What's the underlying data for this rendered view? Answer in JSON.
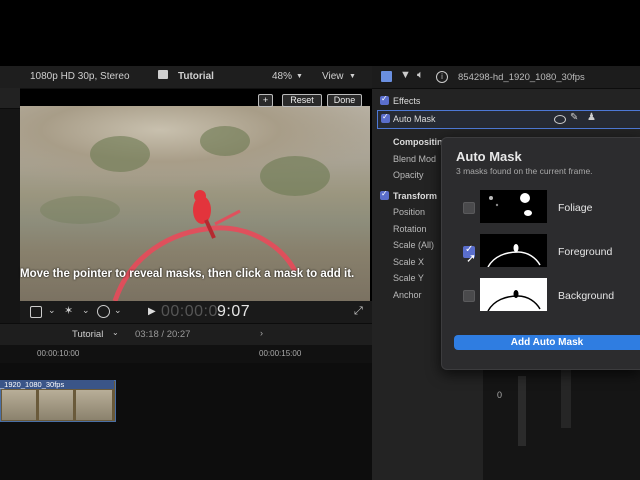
{
  "viewer": {
    "format": "1080p HD 30p, Stereo",
    "project": "Tutorial",
    "zoom": "48%",
    "view_label": "View",
    "add_label": "+",
    "reset_label": "Reset",
    "done_label": "Done",
    "caption": "Move the pointer to reveal masks, then click a mask to add it.",
    "timecode_dim": "00:00:0",
    "timecode_bright": "9:07"
  },
  "timeline": {
    "project": "Tutorial",
    "position": "03:18 / 20:27",
    "ruler_marks": [
      "00:00:10:00",
      "00:00:15:00"
    ],
    "clip_label": "_1920_1080_30fps"
  },
  "inspector": {
    "clip_name": "854298-hd_1920_1080_30fps",
    "effects_label": "Effects",
    "automask_label": "Auto Mask",
    "compositing_label": "Compositin",
    "blend_label": "Blend Mod",
    "opacity_label": "Opacity",
    "transform_label": "Transform",
    "position_label": "Position",
    "rotation_label": "Rotation",
    "scale_all_label": "Scale (All)",
    "scale_x_label": "Scale X",
    "scale_y_label": "Scale Y",
    "anchor_label": "Anchor"
  },
  "popover": {
    "title": "Auto Mask",
    "subtitle": "3 masks found on the current frame.",
    "masks": [
      {
        "label": "Foliage",
        "checked": false
      },
      {
        "label": "Foreground",
        "checked": true
      },
      {
        "label": "Background",
        "checked": false
      }
    ],
    "add_button": "Add Auto Mask"
  },
  "graph": {
    "axis_value": "0"
  },
  "colors": {
    "accent": "#2f7de1",
    "checkbox": "#5a6ecc",
    "selection_border": "#4d78d6"
  }
}
